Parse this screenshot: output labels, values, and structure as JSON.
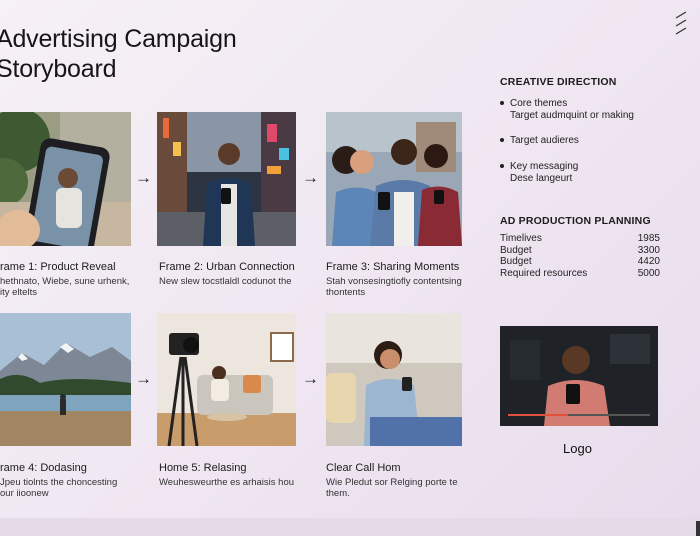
{
  "title_line1": "Advertising Campaign",
  "title_line2": "Storyboard",
  "frames": [
    {
      "title": "rame 1: Product Reveal",
      "desc_line1": "hethnato, Wiebe, sune urhenk,",
      "desc_line2": "ity eltelts"
    },
    {
      "title": "Frame 2: Urban Connection",
      "desc_line1": "New slew tocstlaldl codunot the",
      "desc_line2": ""
    },
    {
      "title": "Frame 3: Sharing Moments",
      "desc_line1": "Stah vonsesingtiofly contentsing",
      "desc_line2": "thontents"
    },
    {
      "title": "rame 4: Dodasing",
      "desc_line1": "Jpeu tiolnts the choncesting",
      "desc_line2": "our iioonew"
    },
    {
      "title": "Home 5: Relasing",
      "desc_line1": "Weuhesweurthe es arhaisis hou",
      "desc_line2": ""
    },
    {
      "title": "Clear Call Hom",
      "desc_line1": "Wie Pledut sor Relging porte te",
      "desc_line2": "them."
    }
  ],
  "arrow_glyph": "→",
  "creative": {
    "heading": "CREATIVE DIRECTION",
    "bullets": [
      {
        "label": "Core themes",
        "sub": "Target audmquint or making"
      },
      {
        "label": "Target audieres",
        "sub": ""
      },
      {
        "label": "Key messaging",
        "sub": "Dese langeurt"
      }
    ]
  },
  "production": {
    "heading": "AD PRODUCTION PLANNING",
    "rows": [
      {
        "label": "Timelives",
        "value": "1985"
      },
      {
        "label": "Budget",
        "value": "3300"
      },
      {
        "label": "Budget",
        "value": "4420"
      },
      {
        "label": "Required resources",
        "value": "5000"
      }
    ]
  },
  "logo": "Logo",
  "colors": {
    "accent": "#e0503a",
    "text": "#1a1a1a"
  }
}
